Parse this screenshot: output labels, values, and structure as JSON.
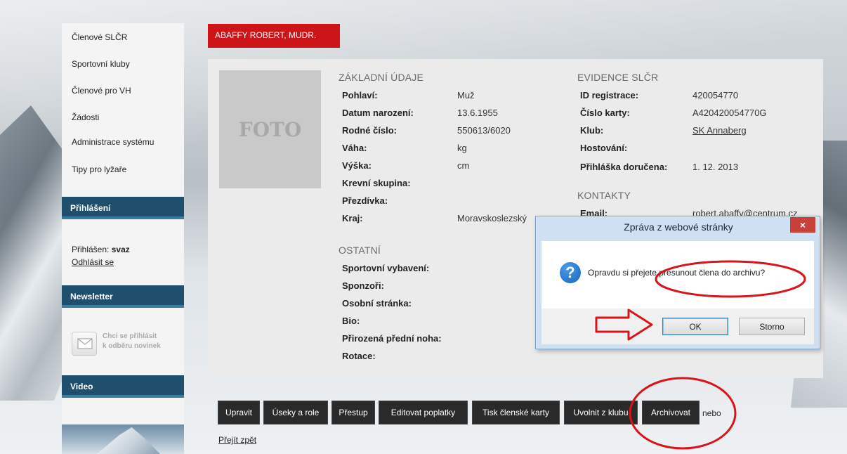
{
  "sidebar": {
    "nav": [
      "Členové SLČR",
      "Sportovní kluby",
      "Členové pro VH",
      "Žádosti",
      "Administrace systému",
      "Tipy pro lyžaře"
    ],
    "login_heading": "Přihlášení",
    "logged_in_label": "Přihlášen:",
    "logged_in_user": "svaz",
    "logout_link": "Odhlásit se",
    "newsletter_heading": "Newsletter",
    "newsletter_text_1": "Chci se přihlásit",
    "newsletter_text_2": "k odběru novinek",
    "video_heading": "Video"
  },
  "member": {
    "name": "ABAFFY ROBERT, MUDR.",
    "photo_placeholder": "FOTO"
  },
  "basic": {
    "title": "ZÁKLADNÍ ÚDAJE",
    "rows": [
      {
        "label": "Pohlaví:",
        "value": "Muž"
      },
      {
        "label": "Datum narození:",
        "value": "13.6.1955"
      },
      {
        "label": "Rodné číslo:",
        "value": "550613/6020"
      },
      {
        "label": "Váha:",
        "value": "kg"
      },
      {
        "label": "Výška:",
        "value": "cm"
      },
      {
        "label": "Krevní skupina:",
        "value": ""
      },
      {
        "label": "Přezdívka:",
        "value": ""
      },
      {
        "label": "Kraj:",
        "value": "Moravskoslezský"
      }
    ]
  },
  "other": {
    "title": "OSTATNÍ",
    "rows": [
      "Sportovní vybavení:",
      "Sponzoři:",
      "Osobní stránka:",
      "Bio:",
      "Přirozená přední noha:",
      "Rotace:"
    ]
  },
  "registry": {
    "title": "EVIDENCE SLČR",
    "rows": [
      {
        "label": "ID registrace:",
        "value": "420054770"
      },
      {
        "label": "Číslo karty:",
        "value": "A420420054770G"
      },
      {
        "label": "Klub:",
        "value": "SK Annaberg"
      },
      {
        "label": "Hostování:",
        "value": ""
      },
      {
        "label": "Přihláška doručena:",
        "value": "1. 12. 2013"
      }
    ]
  },
  "contacts": {
    "title": "KONTAKTY",
    "email_label": "Email:",
    "email_value": "robert.abaffy@centrum.cz"
  },
  "actions": [
    "Upravit",
    "Úseky a role",
    "Přestup",
    "Editovat poplatky",
    "Tisk členské karty",
    "Uvolnit z klubu",
    "Archivovat"
  ],
  "actions_suffix": "nebo",
  "back_link": "Přejít zpět",
  "dialog": {
    "title": "Zpráva z webové stránky",
    "message": "Opravdu si přejete přesunout člena do archivu?",
    "ok": "OK",
    "cancel": "Storno",
    "close": "×"
  },
  "colors": {
    "sidebar_heading": "#1f4f6d",
    "name_tab": "#cc1419",
    "button": "#2a2a2a",
    "annotation": "#d8141a"
  }
}
